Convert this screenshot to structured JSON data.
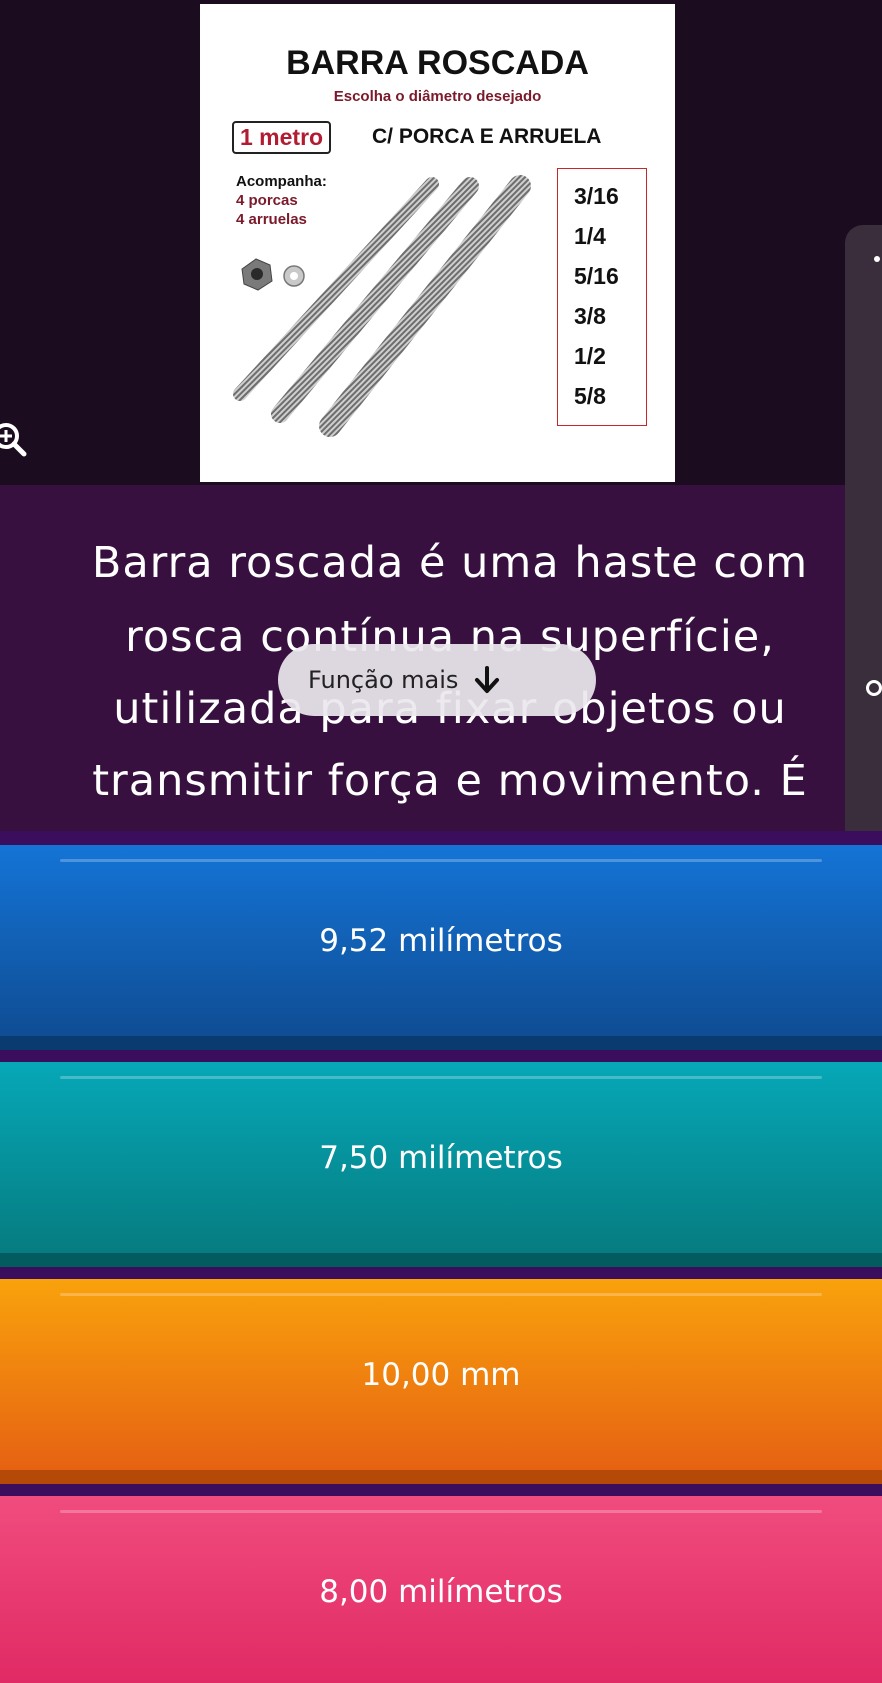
{
  "image": {
    "title": "BARRA ROSCADA",
    "subtitle": "Escolha o diâmetro desejado",
    "metro": "1 metro",
    "porca": "C/ PORCA E ARRUELA",
    "acomp_title": "Acompanha:",
    "acomp_items": [
      "4 porcas",
      "4 arruelas"
    ],
    "sizes": [
      "3/16",
      "1/4",
      "5/16",
      "3/8",
      "1/2",
      "5/8"
    ]
  },
  "question": {
    "lines": [
      "Barra roscada é uma haste com",
      "rosca contínua na superfície,",
      "utilizada para fixar objetos ou",
      "transmitir força e movimento. É"
    ],
    "more_label": "Função mais"
  },
  "answers": [
    {
      "label": "9,52 milímetros",
      "color": "#1474d6"
    },
    {
      "label": "7,50 milímetros",
      "color": "#06a8b8"
    },
    {
      "label": "10,00 mm",
      "color": "#f9a20c"
    },
    {
      "label": "8,00 milímetros",
      "color": "#f14c7e"
    }
  ],
  "icons": {
    "zoom": "zoom-in-icon",
    "more": "arrow-down-icon"
  }
}
